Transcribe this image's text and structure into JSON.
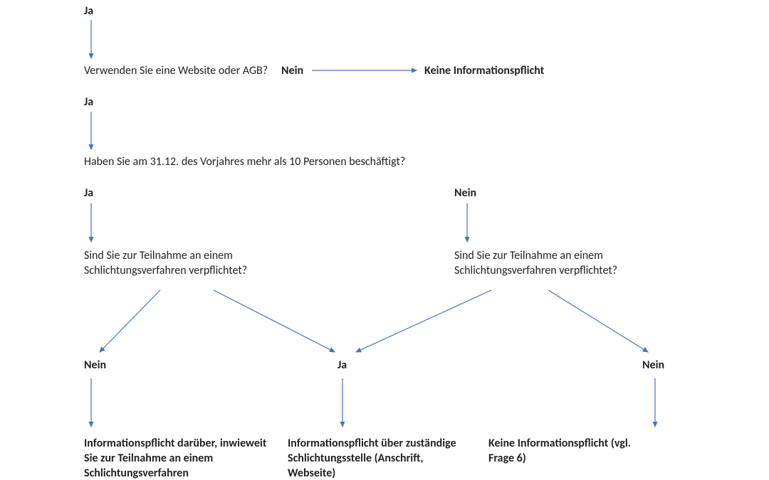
{
  "colors": {
    "arrow": "#4472C4"
  },
  "nodes": {
    "ja1": "Ja",
    "q_website": "Verwenden Sie eine Website oder AGB?",
    "nein_website": "Nein",
    "no_info_top": "Keine Informationspflicht",
    "ja2": "Ja",
    "q_employees": "Haben Sie am 31.12. des Vorjahres mehr als 10 Personen beschäftigt?",
    "ja3": "Ja",
    "nein3": "Nein",
    "q_schlichtung_left": "Sind Sie zur Teilnahme an einem Schlichtungsverfahren verpflichtet?",
    "q_schlichtung_right": "Sind Sie zur Teilnahme an einem Schlichtungsverfahren verpflichtet?",
    "nein_bottom_left": "Nein",
    "ja_bottom_mid": "Ja",
    "nein_bottom_right": "Nein",
    "result_left": "Informationspflicht darüber, inwieweit Sie zur Teilnahme an einem Schlichtungsverfahren",
    "result_mid": "Informationspflicht über zuständige Schlichtungsstelle (Anschrift, Webseite)",
    "result_right": "Keine Informationspflicht (vgl. Frage 6)"
  }
}
